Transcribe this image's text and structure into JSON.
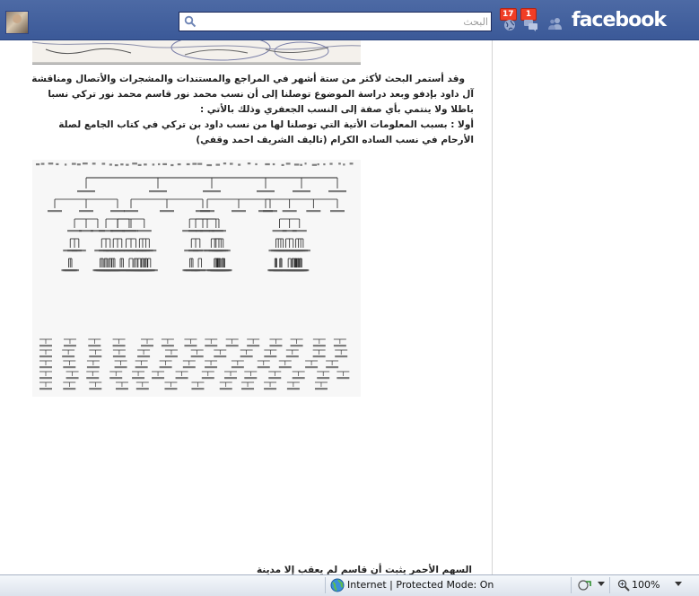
{
  "topbar": {
    "logo": "facebook",
    "search_placeholder": "البحث",
    "notifications": [
      {
        "name": "notifications",
        "count": "17"
      },
      {
        "name": "messages",
        "count": "1"
      },
      {
        "name": "friend-requests",
        "count": ""
      }
    ]
  },
  "post": {
    "paragraph_lines": [
      "وقد أستمر البحث لأكثر من ستة أشهر في المراجع والمستندات والمشجرات والأتصال ومناقشة",
      "آل داود بإدفو وبعد دراسة الموضوع  توصلنا إلى أن نسب محمد نور قاسم محمد نور تركي نسبا",
      "باطلا ولا ينتمي بأي صفة إلى النسب الجعفري وذلك بالأتي :"
    ],
    "point1_lines": [
      "أولا : بسبب المعلومات الأتية التي توصلنا لها من نسب داود بن تركي في كتاب الجامع لصلة",
      "الأرحام في نسب الساده الكرام            (تاليف الشريف احمد وقفي)"
    ],
    "bottom_text": "السهم الأحمر يثبت أن قاسم لم يعقب إلا مدينة"
  },
  "statusbar": {
    "zone_text": "Internet | Protected Mode: On",
    "zoom_text": "100%"
  },
  "colors": {
    "fb_blue": "#3b5998",
    "badge_red": "#f03d25"
  }
}
